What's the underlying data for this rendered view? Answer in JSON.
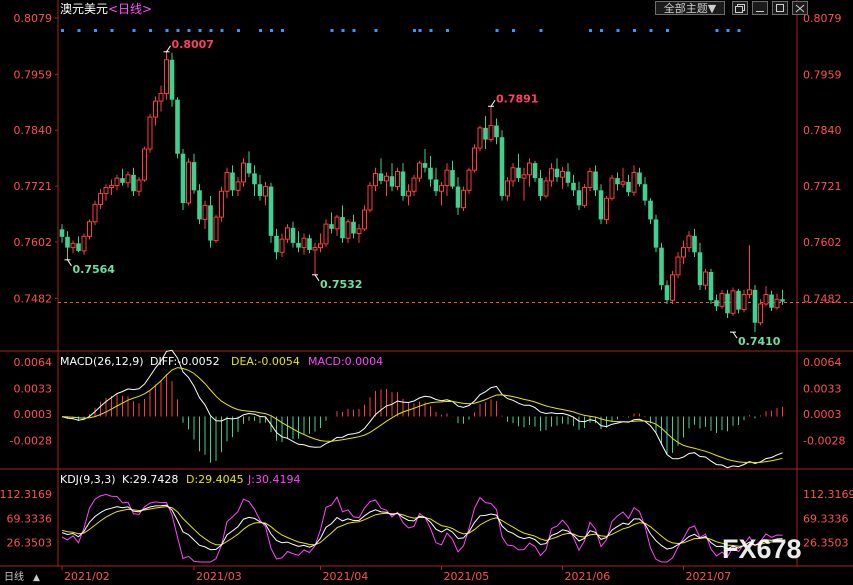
{
  "header": {
    "symbol": "澳元美元",
    "period": "<日线>",
    "theme_label": "全部主题",
    "theme_arrow": "▼",
    "window_icons": [
      "restore-icon",
      "minimize-icon",
      "maximize-icon",
      "close-icon"
    ]
  },
  "main_panel": {
    "y_ticks": [
      "0.8079",
      "0.7959",
      "0.7840",
      "0.7721",
      "0.7602",
      "0.7482"
    ],
    "y_range": [
      0.7406,
      0.8079
    ],
    "current_price_line": 0.7473,
    "annotations": [
      {
        "text": "0.8007",
        "value": 0.8007,
        "candle": 19,
        "kind": "high"
      },
      {
        "text": "0.7891",
        "value": 0.7891,
        "candle": 78,
        "kind": "high"
      },
      {
        "text": "0.7564",
        "value": 0.7564,
        "candle": 1,
        "kind": "low"
      },
      {
        "text": "0.7532",
        "value": 0.7532,
        "candle": 46,
        "kind": "low"
      },
      {
        "text": "0.7410",
        "value": 0.741,
        "candle": 122,
        "kind": "low"
      }
    ]
  },
  "macd_panel": {
    "title": "MACD(26,12,9)",
    "diff": "DIFF:-0.0052",
    "dea": "DEA:-0.0054",
    "macd": "MACD:0.0004",
    "y_ticks": [
      "0.0064",
      "0.0033",
      "0.0003",
      "-0.0028"
    ],
    "y_range": [
      -0.0058,
      0.0064
    ]
  },
  "kdj_panel": {
    "title": "KDJ(9,3,3)",
    "k": "K:29.7428",
    "d": "D:29.4045",
    "j": "J:30.4194",
    "y_ticks": [
      "112.3169",
      "69.3336",
      "26.3503"
    ],
    "y_range": [
      -8,
      125
    ]
  },
  "x_axis": {
    "labels": [
      {
        "text": "2021/02",
        "candle": 0
      },
      {
        "text": "2021/03",
        "candle": 24
      },
      {
        "text": "2021/04",
        "candle": 47
      },
      {
        "text": "2021/05",
        "candle": 69
      },
      {
        "text": "2021/06",
        "candle": 91
      },
      {
        "text": "2021/07",
        "candle": 113
      }
    ]
  },
  "footer": {
    "period_tab": "日线",
    "watermark": "FX678"
  },
  "colors": {
    "up": "#ff3c3c",
    "down": "#40d090",
    "axis_text": "#ff5050",
    "dea_line": "#e6e600",
    "macd_line": "#ff44ff",
    "dot": "#3399ff",
    "grid": "#555555",
    "k_line": "#ffffff",
    "d_line": "#e6e600",
    "j_line": "#ff44ff"
  },
  "chart_data": {
    "type": "candlestick",
    "title": "澳元美元 <日线>",
    "candles_ohlc": [
      [
        0.7629,
        0.764,
        0.76,
        0.7613
      ],
      [
        0.7613,
        0.7625,
        0.7564,
        0.759
      ],
      [
        0.759,
        0.7605,
        0.7578,
        0.7599
      ],
      [
        0.7599,
        0.7614,
        0.758,
        0.7583
      ],
      [
        0.7583,
        0.762,
        0.7575,
        0.7614
      ],
      [
        0.7614,
        0.765,
        0.7608,
        0.7645
      ],
      [
        0.7645,
        0.769,
        0.7638,
        0.7682
      ],
      [
        0.7682,
        0.7715,
        0.7672,
        0.7705
      ],
      [
        0.7705,
        0.7725,
        0.769,
        0.7718
      ],
      [
        0.7718,
        0.7735,
        0.7702,
        0.7722
      ],
      [
        0.7722,
        0.7745,
        0.7712,
        0.7738
      ],
      [
        0.7738,
        0.7758,
        0.7722,
        0.7728
      ],
      [
        0.7728,
        0.7752,
        0.7718,
        0.7745
      ],
      [
        0.7745,
        0.776,
        0.77,
        0.771
      ],
      [
        0.771,
        0.774,
        0.77,
        0.7734
      ],
      [
        0.7734,
        0.7805,
        0.773,
        0.78
      ],
      [
        0.78,
        0.7875,
        0.7792,
        0.7868
      ],
      [
        0.7868,
        0.7912,
        0.785,
        0.7902
      ],
      [
        0.7902,
        0.7935,
        0.788,
        0.7918
      ],
      [
        0.7918,
        0.8007,
        0.7905,
        0.799
      ],
      [
        0.799,
        0.8005,
        0.789,
        0.7905
      ],
      [
        0.7905,
        0.791,
        0.778,
        0.779
      ],
      [
        0.779,
        0.78,
        0.767,
        0.7685
      ],
      [
        0.7685,
        0.778,
        0.768,
        0.7772
      ],
      [
        0.7772,
        0.779,
        0.7705,
        0.7712
      ],
      [
        0.7712,
        0.7725,
        0.764,
        0.765
      ],
      [
        0.765,
        0.769,
        0.763,
        0.768
      ],
      [
        0.768,
        0.77,
        0.759,
        0.7605
      ],
      [
        0.7605,
        0.766,
        0.76,
        0.7655
      ],
      [
        0.7655,
        0.772,
        0.7645,
        0.771
      ],
      [
        0.771,
        0.776,
        0.7695,
        0.775
      ],
      [
        0.775,
        0.7765,
        0.77,
        0.7712
      ],
      [
        0.7712,
        0.774,
        0.77,
        0.773
      ],
      [
        0.773,
        0.778,
        0.772,
        0.777
      ],
      [
        0.777,
        0.7795,
        0.774,
        0.7748
      ],
      [
        0.7748,
        0.7765,
        0.77,
        0.7725
      ],
      [
        0.7725,
        0.7745,
        0.769,
        0.77
      ],
      [
        0.77,
        0.773,
        0.768,
        0.772
      ],
      [
        0.772,
        0.7728,
        0.76,
        0.7615
      ],
      [
        0.7615,
        0.763,
        0.7565,
        0.758
      ],
      [
        0.758,
        0.762,
        0.757,
        0.7608
      ],
      [
        0.7608,
        0.764,
        0.76,
        0.7632
      ],
      [
        0.7632,
        0.7645,
        0.759,
        0.76
      ],
      [
        0.76,
        0.7625,
        0.758,
        0.759
      ],
      [
        0.759,
        0.762,
        0.7575,
        0.761
      ],
      [
        0.761,
        0.7618,
        0.7578,
        0.7585
      ],
      [
        0.7585,
        0.76,
        0.7532,
        0.759
      ],
      [
        0.759,
        0.762,
        0.758,
        0.7598
      ],
      [
        0.7598,
        0.765,
        0.7592,
        0.764
      ],
      [
        0.764,
        0.7665,
        0.762,
        0.763
      ],
      [
        0.763,
        0.766,
        0.7615,
        0.7655
      ],
      [
        0.7655,
        0.768,
        0.76,
        0.761
      ],
      [
        0.761,
        0.765,
        0.76,
        0.7645
      ],
      [
        0.7645,
        0.766,
        0.761,
        0.762
      ],
      [
        0.762,
        0.764,
        0.76,
        0.763
      ],
      [
        0.763,
        0.768,
        0.7625,
        0.767
      ],
      [
        0.767,
        0.773,
        0.7665,
        0.7722
      ],
      [
        0.7722,
        0.776,
        0.771,
        0.7748
      ],
      [
        0.7748,
        0.778,
        0.7725,
        0.7732
      ],
      [
        0.7732,
        0.775,
        0.77,
        0.7742
      ],
      [
        0.7742,
        0.777,
        0.771,
        0.772
      ],
      [
        0.772,
        0.776,
        0.7712,
        0.7752
      ],
      [
        0.7752,
        0.777,
        0.769,
        0.77
      ],
      [
        0.77,
        0.7725,
        0.768,
        0.771
      ],
      [
        0.771,
        0.7745,
        0.77,
        0.7738
      ],
      [
        0.7738,
        0.7775,
        0.773,
        0.777
      ],
      [
        0.777,
        0.78,
        0.775,
        0.776
      ],
      [
        0.776,
        0.7785,
        0.772,
        0.7735
      ],
      [
        0.7735,
        0.776,
        0.77,
        0.771
      ],
      [
        0.771,
        0.773,
        0.768,
        0.7722
      ],
      [
        0.7722,
        0.777,
        0.77,
        0.7755
      ],
      [
        0.7755,
        0.7775,
        0.7715,
        0.772
      ],
      [
        0.772,
        0.774,
        0.766,
        0.7675
      ],
      [
        0.7675,
        0.772,
        0.7668,
        0.7712
      ],
      [
        0.7712,
        0.776,
        0.7705,
        0.7755
      ],
      [
        0.7755,
        0.781,
        0.775,
        0.7802
      ],
      [
        0.7802,
        0.785,
        0.7795,
        0.7845
      ],
      [
        0.7845,
        0.787,
        0.78,
        0.782
      ],
      [
        0.782,
        0.7891,
        0.7815,
        0.785
      ],
      [
        0.785,
        0.7865,
        0.781,
        0.7825
      ],
      [
        0.7825,
        0.784,
        0.769,
        0.77
      ],
      [
        0.77,
        0.774,
        0.769,
        0.7732
      ],
      [
        0.7732,
        0.777,
        0.772,
        0.776
      ],
      [
        0.776,
        0.779,
        0.773,
        0.7738
      ],
      [
        0.7738,
        0.776,
        0.769,
        0.7745
      ],
      [
        0.7745,
        0.778,
        0.772,
        0.777
      ],
      [
        0.777,
        0.7775,
        0.773,
        0.7738
      ],
      [
        0.7738,
        0.7755,
        0.769,
        0.77
      ],
      [
        0.77,
        0.774,
        0.7695,
        0.7732
      ],
      [
        0.7732,
        0.777,
        0.772,
        0.7758
      ],
      [
        0.7758,
        0.778,
        0.773,
        0.774
      ],
      [
        0.774,
        0.7762,
        0.7715,
        0.7752
      ],
      [
        0.7752,
        0.777,
        0.772,
        0.7728
      ],
      [
        0.7728,
        0.7745,
        0.77,
        0.7712
      ],
      [
        0.7712,
        0.773,
        0.767,
        0.768
      ],
      [
        0.768,
        0.7725,
        0.7675,
        0.7718
      ],
      [
        0.7718,
        0.776,
        0.771,
        0.7752
      ],
      [
        0.7752,
        0.7765,
        0.77,
        0.7712
      ],
      [
        0.7712,
        0.7725,
        0.764,
        0.765
      ],
      [
        0.765,
        0.77,
        0.764,
        0.7695
      ],
      [
        0.7695,
        0.7745,
        0.769,
        0.7738
      ],
      [
        0.7738,
        0.775,
        0.7712,
        0.7725
      ],
      [
        0.7725,
        0.776,
        0.7718,
        0.773
      ],
      [
        0.773,
        0.7745,
        0.77,
        0.7708
      ],
      [
        0.7708,
        0.7765,
        0.77,
        0.775
      ],
      [
        0.775,
        0.776,
        0.772,
        0.7725
      ],
      [
        0.7725,
        0.774,
        0.768,
        0.769
      ],
      [
        0.769,
        0.7695,
        0.764,
        0.765
      ],
      [
        0.765,
        0.766,
        0.758,
        0.759
      ],
      [
        0.759,
        0.76,
        0.75,
        0.751
      ],
      [
        0.751,
        0.752,
        0.747,
        0.7478
      ],
      [
        0.7478,
        0.754,
        0.747,
        0.7532
      ],
      [
        0.7532,
        0.758,
        0.7525,
        0.757
      ],
      [
        0.757,
        0.7605,
        0.7555,
        0.759
      ],
      [
        0.759,
        0.7625,
        0.758,
        0.7615
      ],
      [
        0.7615,
        0.763,
        0.757,
        0.758
      ],
      [
        0.758,
        0.76,
        0.75,
        0.751
      ],
      [
        0.751,
        0.7545,
        0.75,
        0.7538
      ],
      [
        0.7538,
        0.7545,
        0.747,
        0.7478
      ],
      [
        0.7478,
        0.749,
        0.7455,
        0.7465
      ],
      [
        0.7465,
        0.75,
        0.746,
        0.7492
      ],
      [
        0.7492,
        0.75,
        0.744,
        0.745
      ],
      [
        0.745,
        0.7505,
        0.7445,
        0.7498
      ],
      [
        0.7498,
        0.7502,
        0.745,
        0.7458
      ],
      [
        0.7458,
        0.75,
        0.7452,
        0.749
      ],
      [
        0.749,
        0.7595,
        0.7482,
        0.75
      ],
      [
        0.75,
        0.751,
        0.741,
        0.743
      ],
      [
        0.743,
        0.748,
        0.7425,
        0.747
      ],
      [
        0.747,
        0.7508,
        0.7465,
        0.749
      ],
      [
        0.749,
        0.7498,
        0.7455,
        0.7462
      ],
      [
        0.7462,
        0.7492,
        0.7458,
        0.748
      ],
      [
        0.748,
        0.75,
        0.7468,
        0.7475
      ]
    ],
    "marker_dots": [
      0,
      3,
      6,
      9,
      13,
      16,
      19,
      21,
      23,
      25,
      27,
      29,
      32,
      36,
      38,
      40,
      49,
      51,
      53,
      57,
      64,
      65,
      67,
      70,
      79,
      82,
      87,
      96,
      98,
      101,
      104,
      107,
      110,
      119,
      121,
      123
    ]
  }
}
